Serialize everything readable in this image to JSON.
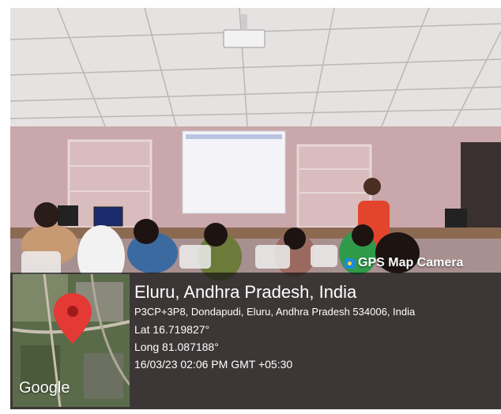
{
  "overlay": {
    "camera_label": "GPS Map Camera",
    "location_title": "Eluru, Andhra Pradesh, India",
    "address": "P3CP+3P8, Dondapudi, Eluru, Andhra Pradesh 534006, India",
    "latitude": "Lat 16.719827°",
    "longitude": "Long 81.087188°",
    "timestamp": "16/03/23 02:06 PM GMT +05:30",
    "map_brand": "Google",
    "pin_icon": "location-pin-icon",
    "pin_color": "#e53935"
  }
}
